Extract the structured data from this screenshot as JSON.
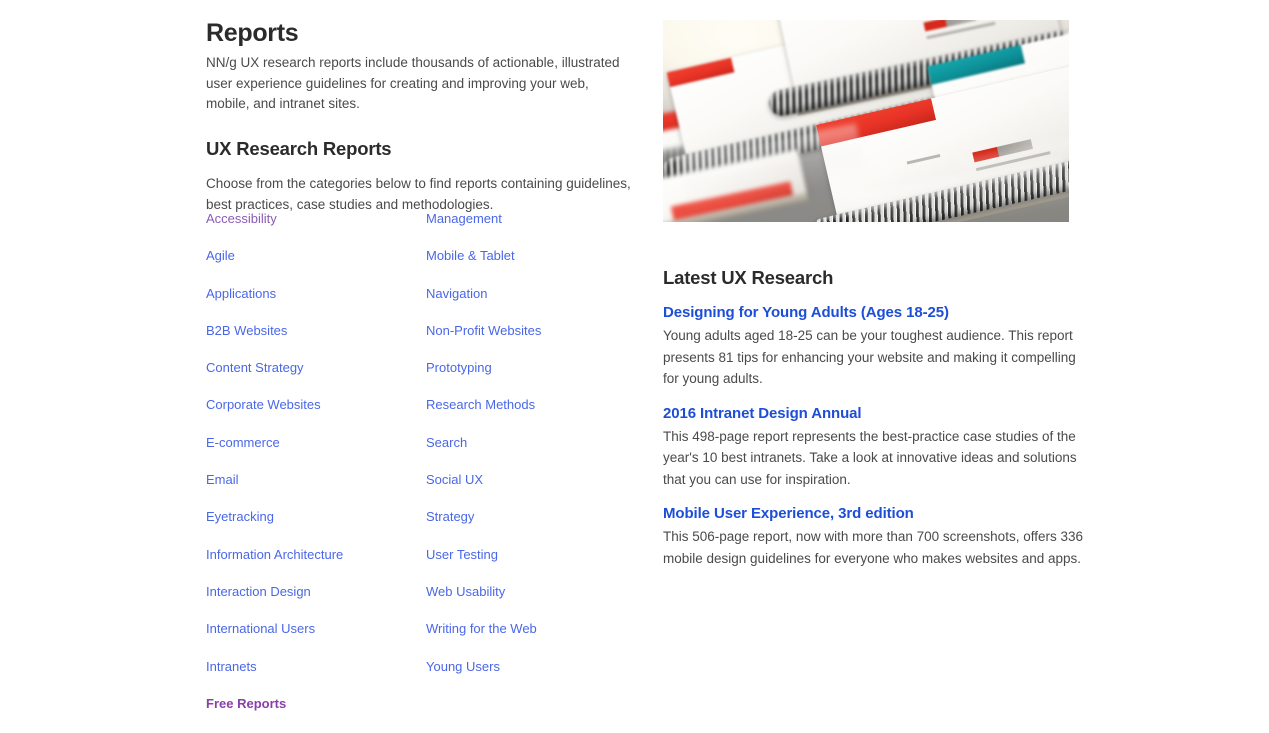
{
  "page": {
    "title": "Reports",
    "intro": "NN/g UX research reports include thousands of actionable, illustrated user experience guidelines for creating and improving your web, mobile, and intranet sites."
  },
  "research_reports": {
    "heading": "UX Research Reports",
    "intro": "Choose from the categories below to find reports containing guidelines, best practices, case studies and methodologies.",
    "columns": [
      {
        "items": [
          {
            "label": "Accessibility",
            "state": "visited"
          },
          {
            "label": "Agile",
            "state": "default"
          },
          {
            "label": "Applications",
            "state": "default"
          },
          {
            "label": "B2B Websites",
            "state": "default"
          },
          {
            "label": "Content Strategy",
            "state": "default"
          },
          {
            "label": "Corporate Websites",
            "state": "default"
          },
          {
            "label": "E-commerce",
            "state": "default"
          },
          {
            "label": "Email",
            "state": "default"
          },
          {
            "label": "Eyetracking",
            "state": "default"
          },
          {
            "label": "Information Architecture",
            "state": "default"
          },
          {
            "label": "Interaction Design",
            "state": "default"
          },
          {
            "label": "International Users",
            "state": "default"
          },
          {
            "label": "Intranets",
            "state": "default"
          },
          {
            "label": "Free Reports",
            "state": "visited-bold"
          }
        ]
      },
      {
        "items": [
          {
            "label": "Management",
            "state": "default"
          },
          {
            "label": "Mobile & Tablet",
            "state": "default"
          },
          {
            "label": "Navigation",
            "state": "default"
          },
          {
            "label": "Non-Profit Websites",
            "state": "default"
          },
          {
            "label": "Prototyping",
            "state": "default"
          },
          {
            "label": "Research Methods",
            "state": "default"
          },
          {
            "label": "Search",
            "state": "default"
          },
          {
            "label": "Social UX",
            "state": "default"
          },
          {
            "label": "Strategy",
            "state": "default"
          },
          {
            "label": "User Testing",
            "state": "default"
          },
          {
            "label": "Web Usability",
            "state": "default"
          },
          {
            "label": "Writing for the Web",
            "state": "default"
          },
          {
            "label": "Young Users",
            "state": "default"
          }
        ]
      }
    ]
  },
  "hero_image": {
    "name": "spiral-bound-reports-photo",
    "alt": "Stack of spiral-bound UX research reports on a glossy table",
    "colors": {
      "accent_red": "#e83326",
      "accent_teal": "#0d9098",
      "cover": "#ffffff",
      "table": "#949391",
      "coil_dark": "#1d1d1d"
    }
  },
  "latest": {
    "heading": "Latest UX Research",
    "items": [
      {
        "title": "Designing for Young Adults (Ages 18-25)",
        "desc": "Young adults aged 18-25 can be your toughest audience. This report presents 81 tips for enhancing your website and making it compelling for young adults."
      },
      {
        "title": "2016 Intranet Design Annual",
        "desc": "This 498-page report represents the best-practice case studies of the year's 10 best intranets. Take a look at innovative ideas and solutions that you can use for inspiration."
      },
      {
        "title": "Mobile User Experience, 3rd edition",
        "desc": "This 506-page report, now with more than 700 screenshots, offers 336 mobile design guidelines for everyone who makes websites and apps."
      }
    ]
  },
  "theme": {
    "link_blue": "#4a67e8",
    "link_visited": "#8b5cb8",
    "report_title_blue": "#1d4ed8",
    "body_text": "#4a4a4a",
    "heading_text": "#2b2b2b",
    "background": "#ffffff"
  }
}
